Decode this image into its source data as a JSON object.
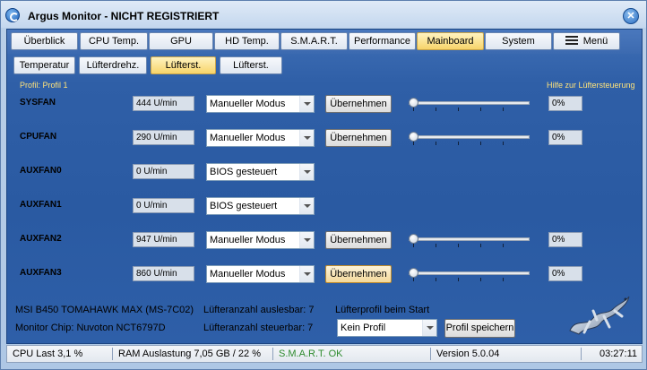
{
  "window": {
    "title": "Argus Monitor - NICHT REGISTRIERT",
    "close_symbol": "✕"
  },
  "main_tabs": [
    {
      "label": "Überblick"
    },
    {
      "label": "CPU Temp."
    },
    {
      "label": "GPU"
    },
    {
      "label": "HD Temp."
    },
    {
      "label": "S.M.A.R.T."
    },
    {
      "label": "Performance"
    },
    {
      "label": "Mainboard",
      "active": true
    },
    {
      "label": "System"
    },
    {
      "label": "Menü"
    }
  ],
  "sub_tabs": [
    {
      "label": "Temperatur"
    },
    {
      "label": "Lüfterdrehz."
    },
    {
      "label": "Lüfterst.",
      "active": true
    },
    {
      "label": "Lüfterst."
    }
  ],
  "profile_label": "Profil: Profil 1",
  "help_link": "Hilfe zur Lüftersteuerung",
  "fans": [
    {
      "name": "SYSFAN",
      "rpm": "444 U/min",
      "mode": "Manueller Modus",
      "apply": "Übernehmen",
      "level": 0.0,
      "percent": "0%"
    },
    {
      "name": "CPUFAN",
      "rpm": "290 U/min",
      "mode": "Manueller Modus",
      "apply": "Übernehmen",
      "level": 0.0,
      "percent": "0%"
    },
    {
      "name": "AUXFAN0",
      "rpm": "0 U/min",
      "mode": "BIOS gesteuert"
    },
    {
      "name": "AUXFAN1",
      "rpm": "0 U/min",
      "mode": "BIOS gesteuert"
    },
    {
      "name": "AUXFAN2",
      "rpm": "947 U/min",
      "mode": "Manueller Modus",
      "apply": "Übernehmen",
      "level": 0.0,
      "percent": "0%"
    },
    {
      "name": "AUXFAN3",
      "rpm": "860 U/min",
      "mode": "Manueller Modus",
      "apply": "Übernehmen",
      "level": 0.0,
      "percent": "0%"
    }
  ],
  "info": {
    "board": "MSI B450 TOMAHAWK MAX (MS-7C02)",
    "chip": "Monitor Chip: Nuvoton NCT6797D",
    "readable": "Lüfteranzahl auslesbar: 7",
    "controllable": "Lüfteranzahl steuerbar: 7",
    "startup_profile_label": "Lüfterprofil beim Start",
    "startup_profile_value": "Kein Profil",
    "save_button": "Profil speichern"
  },
  "status": {
    "cpu": "CPU Last 3,1 %",
    "ram": "RAM Auslastung 7,05 GB / 22 %",
    "smart": "S.M.A.R.T. OK",
    "smart_color": "#2e8b2e",
    "version": "Version 5.0.04",
    "time": "03:27:11"
  }
}
